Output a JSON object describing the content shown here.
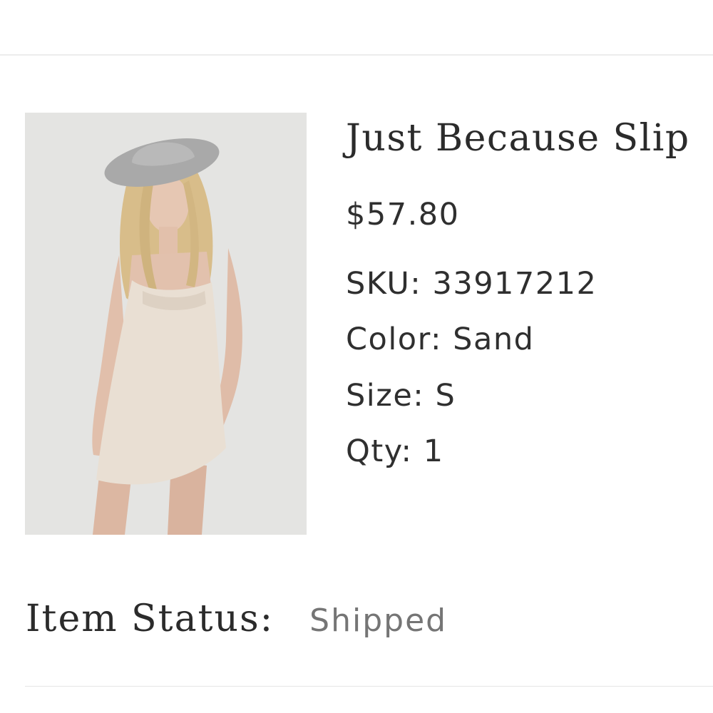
{
  "product": {
    "name": "Just Because Slip",
    "price": "$57.80",
    "sku": {
      "label": "SKU:",
      "value": "33917212"
    },
    "color": {
      "label": "Color:",
      "value": "Sand"
    },
    "size": {
      "label": "Size:",
      "value": "S"
    },
    "qty": {
      "label": "Qty:",
      "value": "1"
    },
    "image_alt": "Just Because Slip"
  },
  "status": {
    "label": "Item Status:",
    "value": "Shipped"
  },
  "colors": {
    "text_dark": "#2b2b2b",
    "text_muted": "#757575",
    "photo_background": "#e3e3e1",
    "dress": "#e8ddd1"
  }
}
